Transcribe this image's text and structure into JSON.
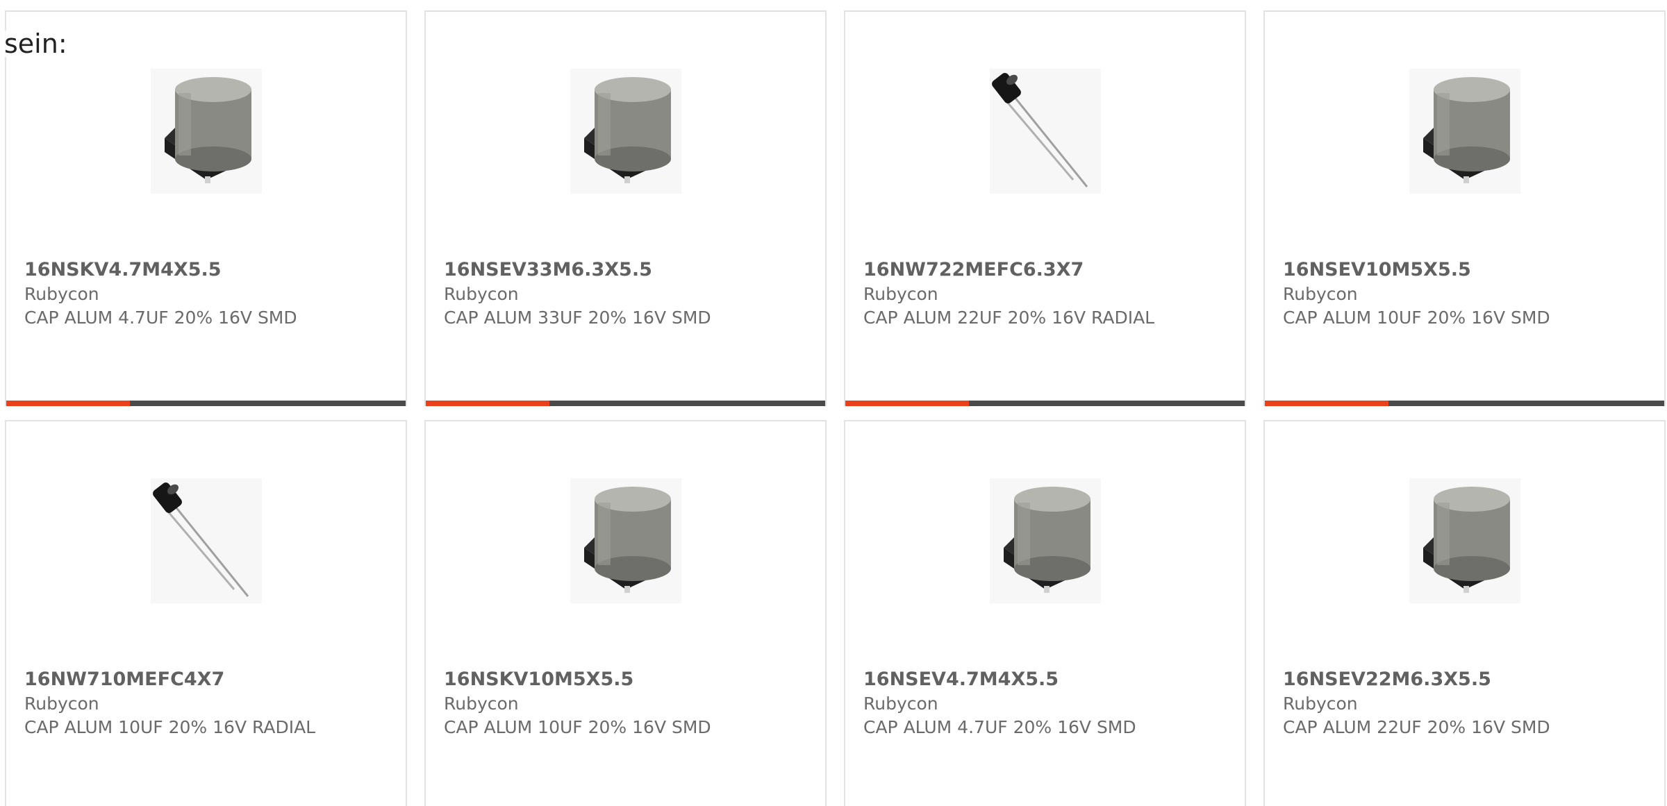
{
  "intro_text": "sein:",
  "colors": {
    "accent": "#e8411b",
    "bar_track": "#4a4a4a",
    "border": "#e2e2e2"
  },
  "products": [
    {
      "part_number": "16NSKV4.7M4X5.5",
      "manufacturer": "Rubycon",
      "description": "CAP ALUM 4.7UF 20% 16V SMD",
      "image_icon": "smd-electrolytic-capacitor-image",
      "progress": 0.31
    },
    {
      "part_number": "16NSEV33M6.3X5.5",
      "manufacturer": "Rubycon",
      "description": "CAP ALUM 33UF 20% 16V SMD",
      "image_icon": "smd-electrolytic-capacitor-image",
      "progress": 0.31
    },
    {
      "part_number": "16NW722MEFC6.3X7",
      "manufacturer": "Rubycon",
      "description": "CAP ALUM 22UF 20% 16V RADIAL",
      "image_icon": "radial-capacitor-image",
      "progress": 0.31
    },
    {
      "part_number": "16NSEV10M5X5.5",
      "manufacturer": "Rubycon",
      "description": "CAP ALUM 10UF 20% 16V SMD",
      "image_icon": "smd-electrolytic-capacitor-image",
      "progress": 0.31
    },
    {
      "part_number": "16NW710MEFC4X7",
      "manufacturer": "Rubycon",
      "description": "CAP ALUM 10UF 20% 16V RADIAL",
      "image_icon": "radial-capacitor-image"
    },
    {
      "part_number": "16NSKV10M5X5.5",
      "manufacturer": "Rubycon",
      "description": "CAP ALUM 10UF 20% 16V SMD",
      "image_icon": "smd-electrolytic-capacitor-image"
    },
    {
      "part_number": "16NSEV4.7M4X5.5",
      "manufacturer": "Rubycon",
      "description": "CAP ALUM 4.7UF 20% 16V SMD",
      "image_icon": "smd-electrolytic-capacitor-image"
    },
    {
      "part_number": "16NSEV22M6.3X5.5",
      "manufacturer": "Rubycon",
      "description": "CAP ALUM 22UF 20% 16V SMD",
      "image_icon": "smd-electrolytic-capacitor-image"
    }
  ]
}
